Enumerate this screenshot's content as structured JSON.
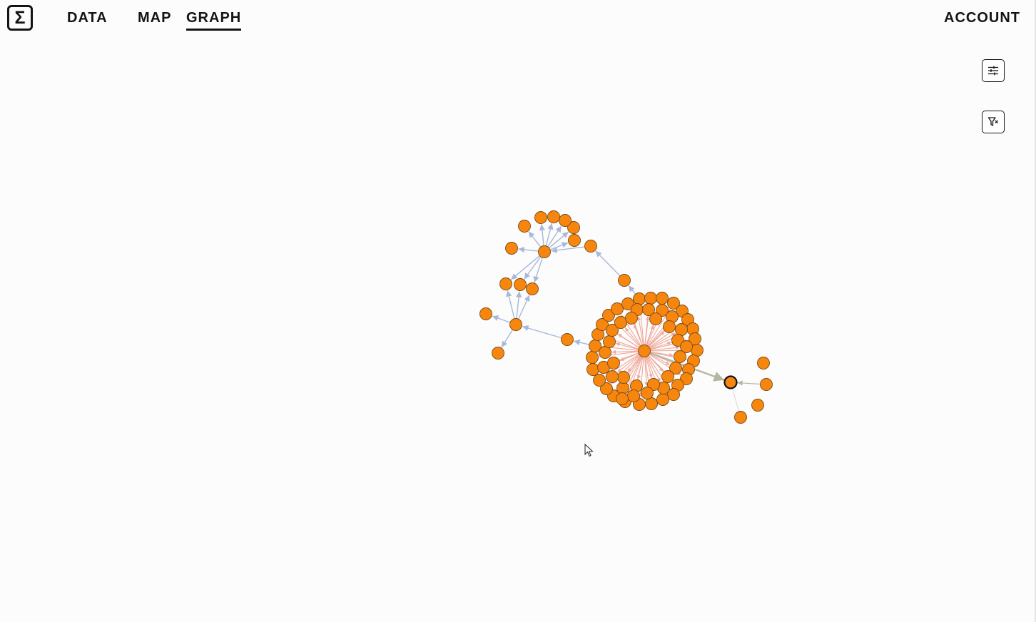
{
  "nav": {
    "logo_glyph": "Σ",
    "links": [
      {
        "label": "DATA"
      },
      {
        "label": "MAP"
      },
      {
        "label": "GRAPH",
        "active": true
      }
    ],
    "account": "ACCOUNT"
  },
  "toolbar": {
    "settings_icon": "sliders-icon",
    "filter_icon": "filter-clear-icon"
  },
  "graph": {
    "node_color": "#f7860f",
    "node_stroke": "#7a4a14",
    "edge_color_default": "#a8b8d8",
    "edge_color_hub": "#f0a89a",
    "edge_color_link": "#b4b8a0",
    "selected_stroke": "#111111"
  }
}
